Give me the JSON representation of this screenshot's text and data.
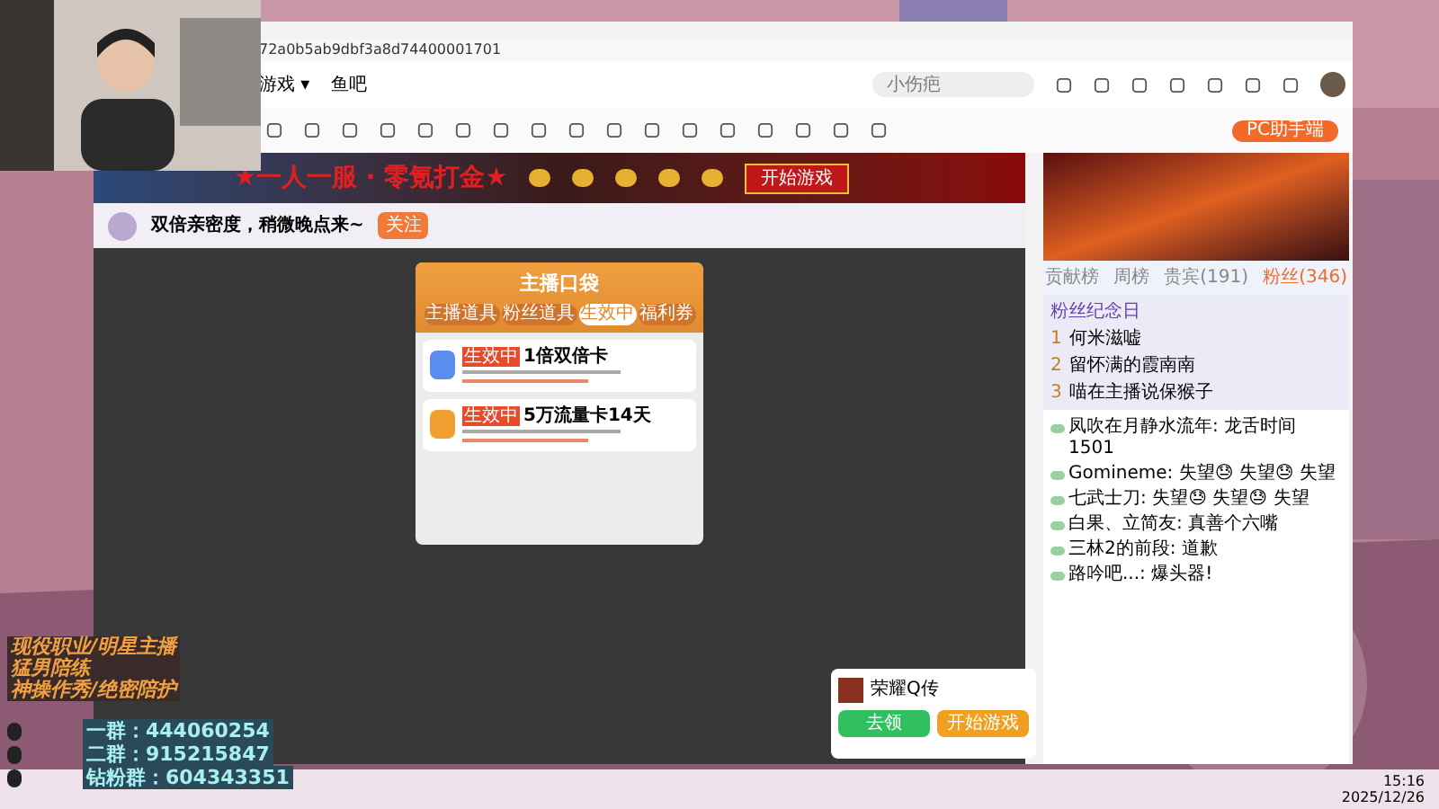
{
  "browser": {
    "url": "72a0b5ab9dbf3a8d74400001701",
    "nav": [
      {
        "label": "游戏 ▾"
      },
      {
        "label": "鱼吧"
      }
    ],
    "search": {
      "placeholder": "小伤疤"
    },
    "pc_button": "PC助手端"
  },
  "banner": {
    "slogan": "★一人一服 · 零氪打金★",
    "button": "开始游戏"
  },
  "room": {
    "title": "双倍亲密度，稍微晚点来~",
    "follow": "关注"
  },
  "pocket": {
    "title": "主播口袋",
    "tabs": [
      {
        "label": "主播道具",
        "selected": false
      },
      {
        "label": "粉丝道具",
        "selected": false
      },
      {
        "label": "生效中",
        "selected": true
      },
      {
        "label": "福利券",
        "selected": false
      }
    ],
    "items": [
      {
        "tag": "生效中",
        "name": "1倍双倍卡",
        "color": "#5b8def"
      },
      {
        "tag": "生效中",
        "name": "5万流量卡14天",
        "color": "#f0a030"
      }
    ]
  },
  "chat": {
    "tabs": [
      {
        "label": "贡献榜",
        "selected": false
      },
      {
        "label": "周榜",
        "selected": false
      },
      {
        "label": "贵宾(191)",
        "selected": false
      },
      {
        "label": "粉丝(346)",
        "selected": true
      }
    ],
    "anniv": "粉丝纪念日",
    "fans": [
      {
        "rank": "1",
        "name": "何米滋嘘"
      },
      {
        "rank": "2",
        "name": "留怀满的霞南南"
      },
      {
        "rank": "3",
        "name": "喵在主播说保猴子"
      }
    ],
    "messages": [
      {
        "user": "凤吹在月静水流年:",
        "text": "龙舌时间 1501"
      },
      {
        "user": "Gomineme:",
        "text": "失望😓 失望😓 失望"
      },
      {
        "user": "七武士刀:",
        "text": "失望😓 失望😓 失望"
      },
      {
        "user": "白果、立简友:",
        "text": "真善个六嘴"
      },
      {
        "user": "三林2的前段:",
        "text": "道歉"
      },
      {
        "user": "路吟吧...:",
        "text": "爆头器!"
      }
    ]
  },
  "promo": {
    "name": "荣耀Q传",
    "buttons": [
      "去领",
      "开始游戏"
    ]
  },
  "overlay": {
    "lines": [
      "现役职业/明星主播",
      "猛男陪练",
      "神操作秀/绝密陪护"
    ],
    "groups": [
      {
        "label": "一群：444060254"
      },
      {
        "label": "二群：915215847"
      },
      {
        "label": "钻粉群：604343351"
      }
    ]
  },
  "taskbar": {
    "time": "15:16",
    "date": "2025/12/26"
  }
}
